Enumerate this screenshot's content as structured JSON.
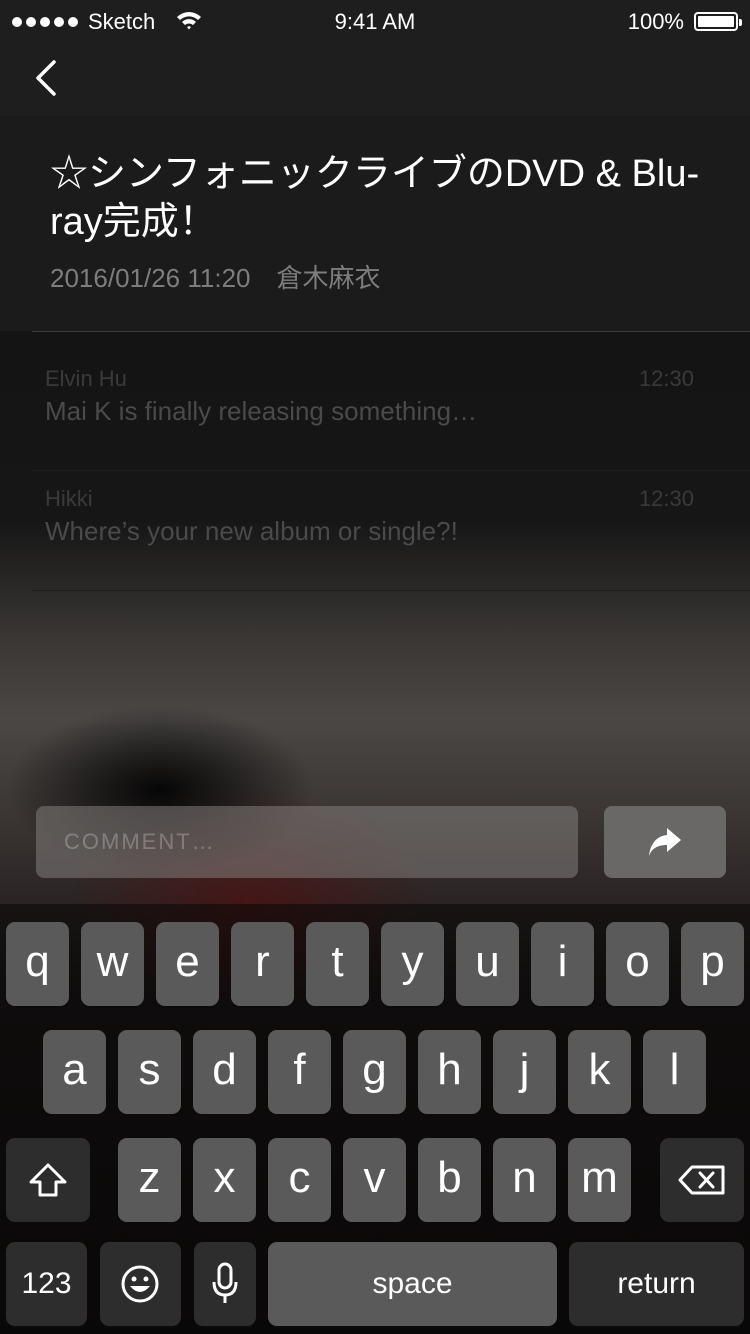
{
  "status_bar": {
    "carrier": "Sketch",
    "time": "9:41 AM",
    "battery": "100%"
  },
  "nav": {
    "back_icon": "chevron-left-icon"
  },
  "post": {
    "title": "☆シンフォニックライブのDVD & Blu-ray完成！",
    "date": "2016/01/26 11:20",
    "author": "倉木麻衣"
  },
  "comments": [
    {
      "name": "Elvin Hu",
      "time": "12:30",
      "text": "Mai K is finally releasing something…"
    },
    {
      "name": "Hikki",
      "time": "12:30",
      "text": "Where’s your new album or single?!"
    }
  ],
  "comment_bar": {
    "placeholder": "COMMENT…",
    "send_icon": "share-arrow-icon"
  },
  "keyboard": {
    "row1": [
      "q",
      "w",
      "e",
      "r",
      "t",
      "y",
      "u",
      "i",
      "o",
      "p"
    ],
    "row2": [
      "a",
      "s",
      "d",
      "f",
      "g",
      "h",
      "j",
      "k",
      "l"
    ],
    "row3": [
      "z",
      "x",
      "c",
      "v",
      "b",
      "n",
      "m"
    ],
    "numbers_label": "123",
    "space_label": "space",
    "return_label": "return",
    "icons": [
      "shift-icon",
      "delete-icon",
      "emoji-icon",
      "microphone-icon"
    ]
  }
}
